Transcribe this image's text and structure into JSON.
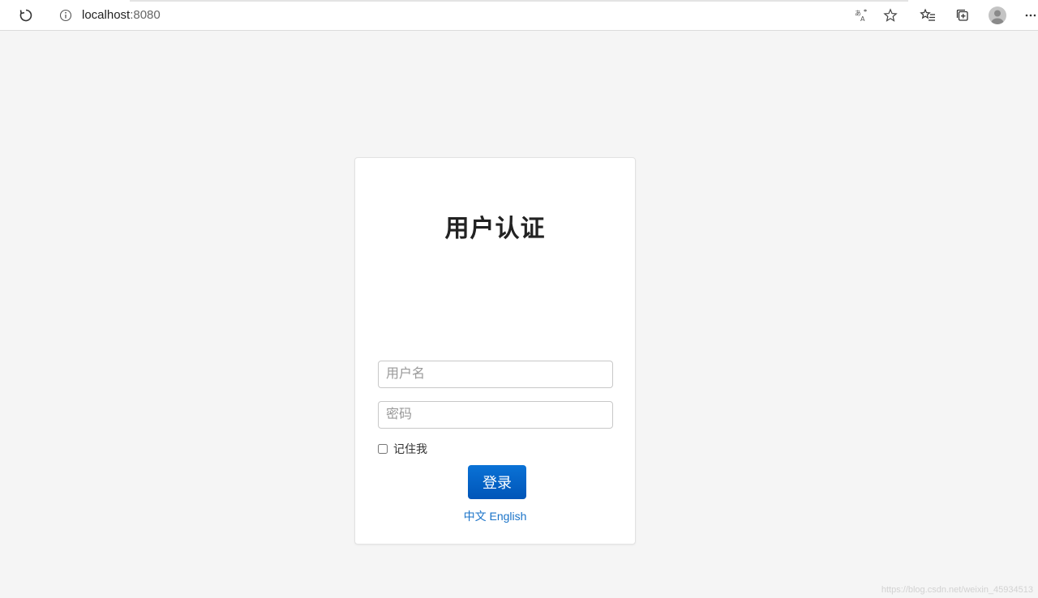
{
  "browser": {
    "url_host": "localhost",
    "url_port": ":8080",
    "icons": [
      "refresh-icon",
      "info-icon",
      "translate-icon",
      "star-icon",
      "favorites-icon",
      "collections-icon",
      "profile-avatar",
      "more-icon"
    ]
  },
  "login": {
    "title": "用户认证",
    "username_placeholder": "用户名",
    "password_placeholder": "密码",
    "remember_label": "记住我",
    "submit_label": "登录",
    "lang_zh": "中文",
    "lang_en": "English"
  },
  "watermark": "https://blog.csdn.net/weixin_45934513",
  "colors": {
    "accent": "#0a66c8",
    "link": "#1a73c8",
    "background": "#f5f5f5"
  }
}
